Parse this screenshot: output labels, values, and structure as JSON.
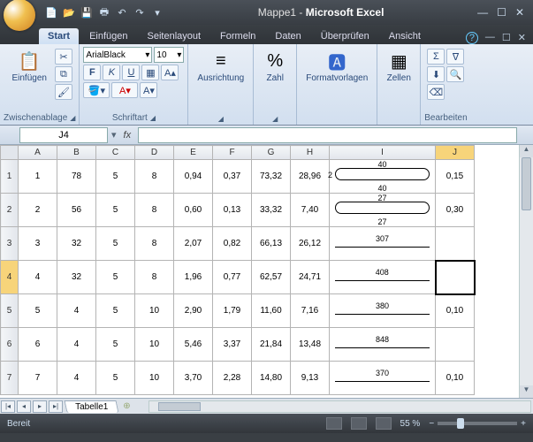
{
  "title": {
    "doc": "Mappe1",
    "sep": " - ",
    "app": "Microsoft Excel"
  },
  "tabs": [
    "Start",
    "Einfügen",
    "Seitenlayout",
    "Formeln",
    "Daten",
    "Überprüfen",
    "Ansicht"
  ],
  "active_tab": 0,
  "ribbon": {
    "clipboard": {
      "label": "Zwischenablage",
      "paste": "Einfügen"
    },
    "font": {
      "label": "Schriftart",
      "name": "ArialBlack",
      "size": "10",
      "bold": "F",
      "italic": "K",
      "underline": "U"
    },
    "align": {
      "label": "Ausrichtung"
    },
    "number": {
      "label": "Zahl",
      "icon": "%"
    },
    "styles": {
      "label": "Formatvorlagen"
    },
    "cells": {
      "label": "Zellen"
    },
    "editing": {
      "label": "Bearbeiten",
      "sigma": "Σ"
    }
  },
  "namebox": "J4",
  "cols": [
    "A",
    "B",
    "C",
    "D",
    "E",
    "F",
    "G",
    "H",
    "I",
    "J"
  ],
  "active_col_idx": 9,
  "active_row": 4,
  "rows": [
    {
      "n": "1",
      "c": [
        "1",
        "78",
        "5",
        "8",
        "0,94",
        "0,37",
        "73,32",
        "28,96",
        {
          "shape": "round2",
          "top": "40",
          "bot": "40",
          "left": "2"
        },
        "0,15"
      ]
    },
    {
      "n": "2",
      "c": [
        "2",
        "56",
        "5",
        "8",
        "0,60",
        "0,13",
        "33,32",
        "7,40",
        {
          "shape": "round2",
          "top": "27",
          "bot": "27",
          "left": ""
        },
        "0,30"
      ]
    },
    {
      "n": "3",
      "c": [
        "3",
        "32",
        "5",
        "8",
        "2,07",
        "0,82",
        "66,13",
        "26,12",
        {
          "shape": "line",
          "mid": "307"
        },
        ""
      ]
    },
    {
      "n": "4",
      "c": [
        "4",
        "32",
        "5",
        "8",
        "1,96",
        "0,77",
        "62,57",
        "24,71",
        {
          "shape": "line",
          "mid": "408"
        },
        ""
      ],
      "sel": 9
    },
    {
      "n": "5",
      "c": [
        "5",
        "4",
        "5",
        "10",
        "2,90",
        "1,79",
        "11,60",
        "7,16",
        {
          "shape": "line",
          "mid": "380"
        },
        "0,10"
      ]
    },
    {
      "n": "6",
      "c": [
        "6",
        "4",
        "5",
        "10",
        "5,46",
        "3,37",
        "21,84",
        "13,48",
        {
          "shape": "line",
          "mid": "848"
        },
        ""
      ]
    },
    {
      "n": "7",
      "c": [
        "7",
        "4",
        "5",
        "10",
        "3,70",
        "2,28",
        "14,80",
        "9,13",
        {
          "shape": "line",
          "mid": "370"
        },
        "0,10"
      ]
    }
  ],
  "sheet": "Tabelle1",
  "status": {
    "ready": "Bereit",
    "zoom": "55 %"
  }
}
